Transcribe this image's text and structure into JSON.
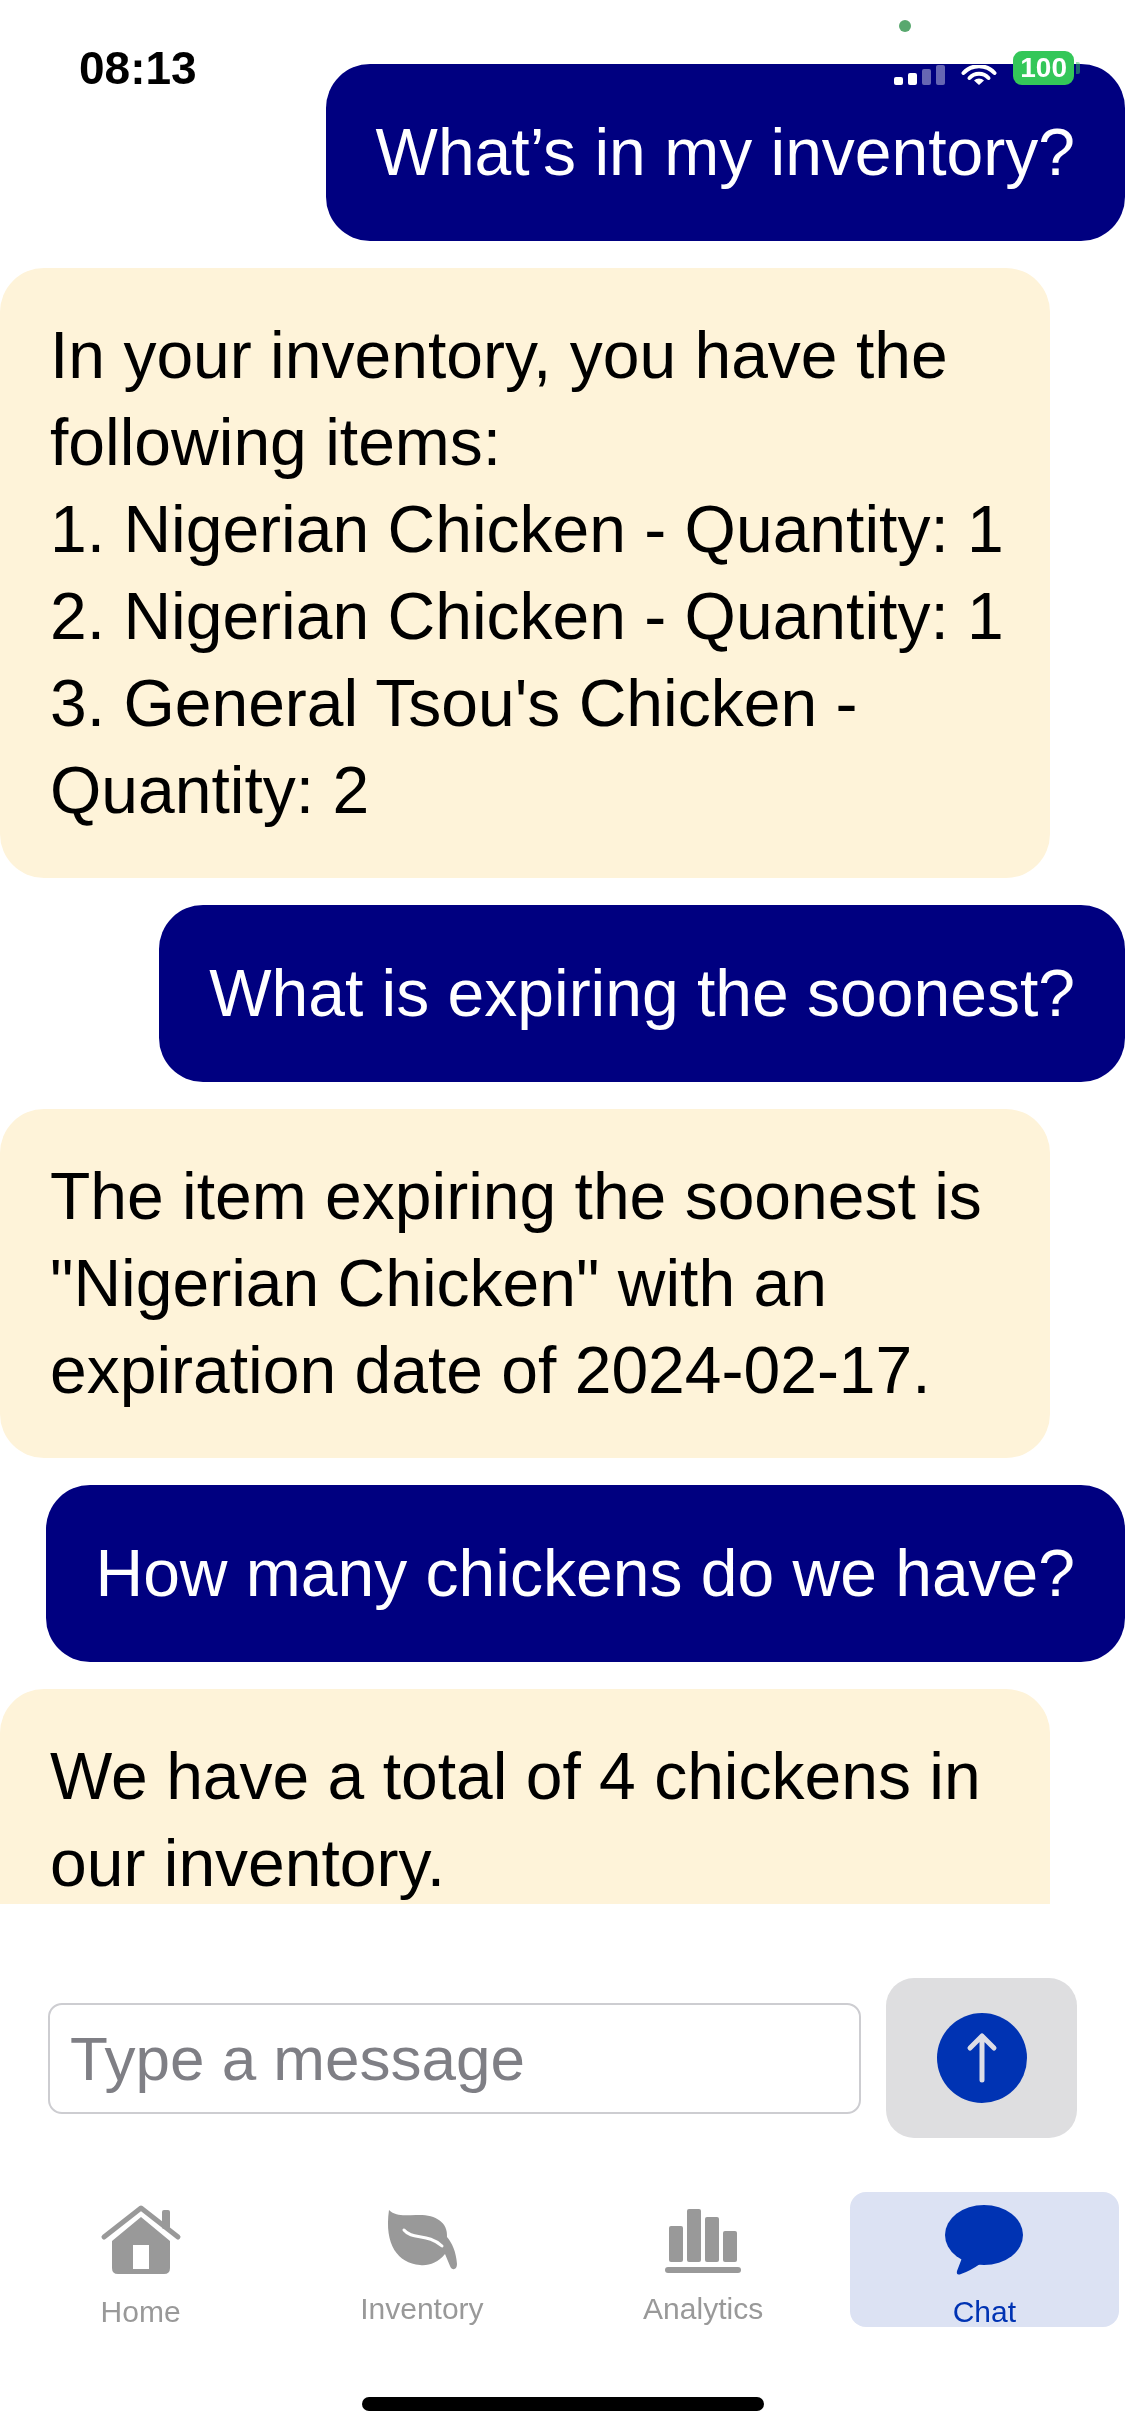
{
  "status_bar": {
    "time": "08:13",
    "battery": "100"
  },
  "messages": [
    {
      "kind": "user",
      "text": "What’s in my inventory?"
    },
    {
      "kind": "assistant",
      "text": "In your inventory, you have the following items:\n1. Nigerian Chicken - Quantity: 1\n2. Nigerian Chicken - Quantity: 1\n3. General Tsou's Chicken - Quantity: 2"
    },
    {
      "kind": "user",
      "text": "What is expiring the soonest?"
    },
    {
      "kind": "assistant",
      "text": "The item expiring the soonest is \"Nigerian Chicken\" with an expiration date of 2024-02-17."
    },
    {
      "kind": "user",
      "text": "How many chickens do we have?"
    },
    {
      "kind": "assistant",
      "text": "We have a total of 4 chickens in our inventory."
    }
  ],
  "composer": {
    "placeholder": "Type a message"
  },
  "tab_bar": [
    {
      "label": "Home",
      "selected": false
    },
    {
      "label": "Inventory",
      "selected": false
    },
    {
      "label": "Analytics",
      "selected": false
    },
    {
      "label": "Chat",
      "selected": true
    }
  ]
}
